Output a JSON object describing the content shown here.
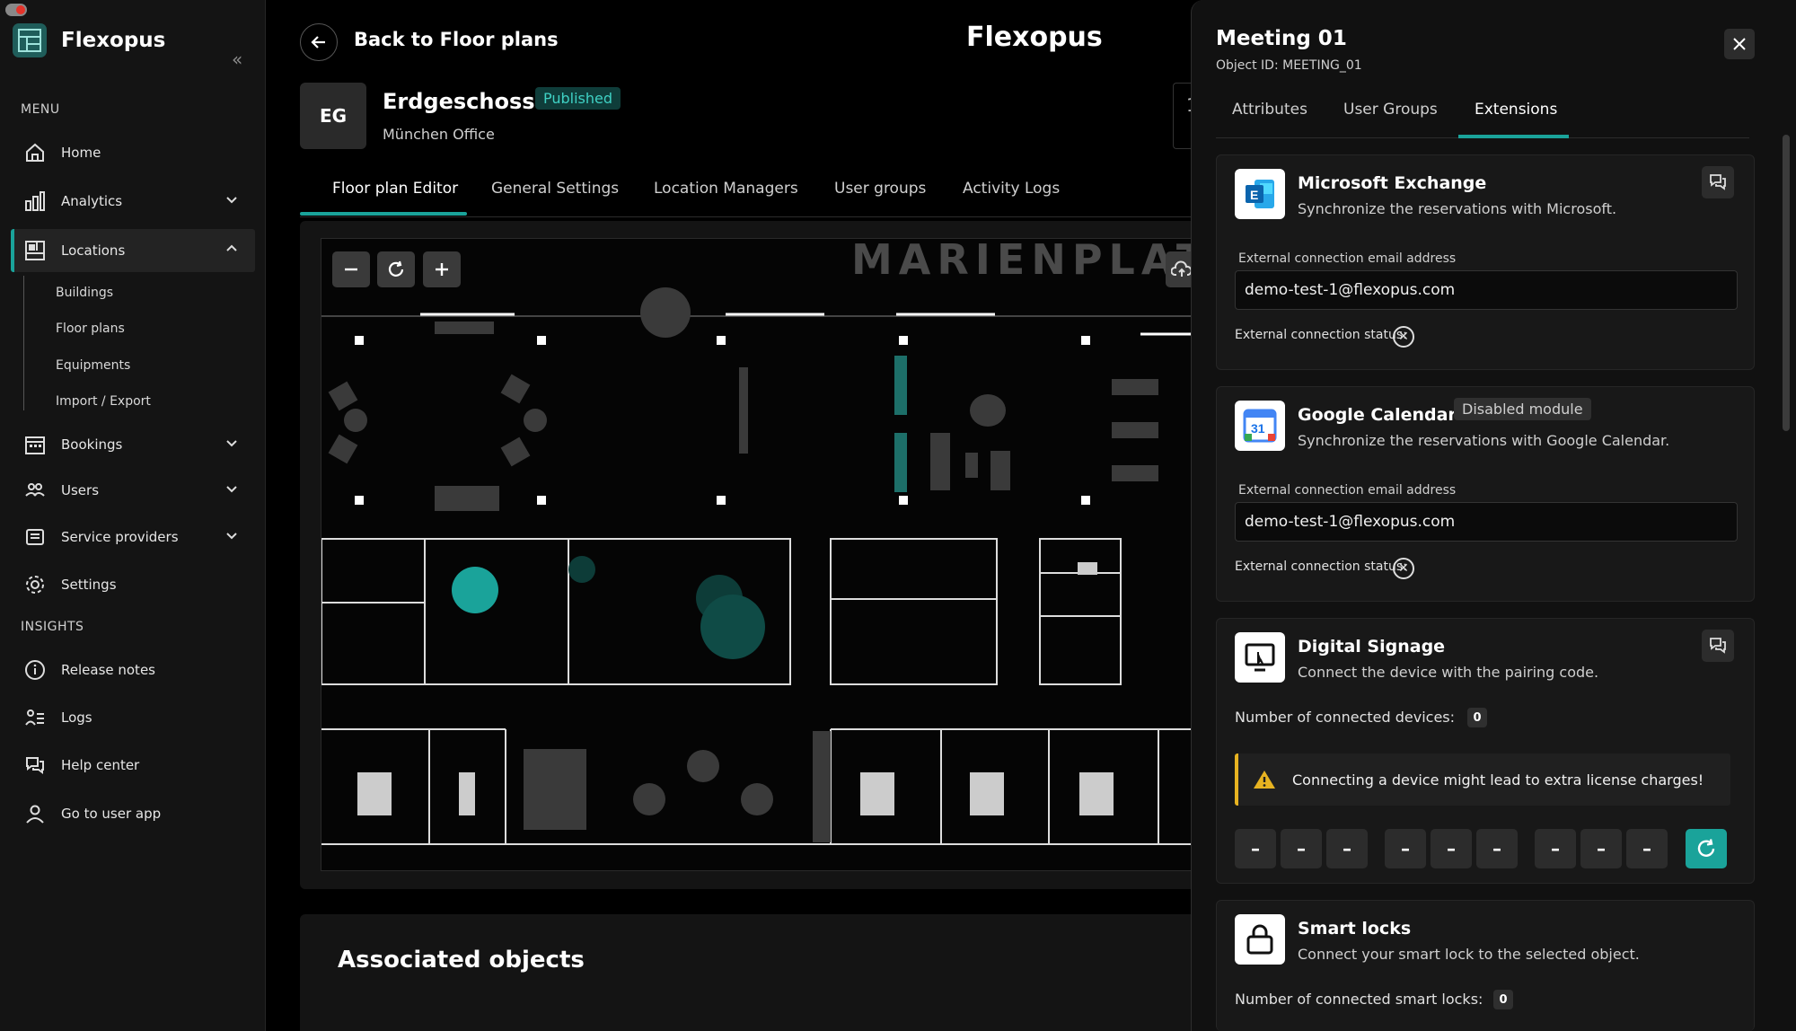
{
  "brand": {
    "name": "Flexopus",
    "collapse_glyph": "«",
    "accent_color": "#1aa39a"
  },
  "sidebar": {
    "menu_label": "MENU",
    "insights_label": "INSIGHTS",
    "items": [
      {
        "label": "Home",
        "icon": "home-icon"
      },
      {
        "label": "Analytics",
        "icon": "bar-chart-icon"
      },
      {
        "label": "Locations",
        "icon": "floor-plan-icon",
        "active": true
      },
      {
        "label": "Bookings",
        "icon": "calendar-icon"
      },
      {
        "label": "Users",
        "icon": "users-icon"
      },
      {
        "label": "Service providers",
        "icon": "id-card-icon"
      },
      {
        "label": "Settings",
        "icon": "gear-icon"
      }
    ],
    "location_subitems": [
      "Buildings",
      "Floor plans",
      "Equipments",
      "Import / Export"
    ],
    "insight_items": [
      {
        "label": "Release notes",
        "icon": "info-icon"
      },
      {
        "label": "Logs",
        "icon": "logs-icon"
      },
      {
        "label": "Help center",
        "icon": "chat-icon"
      },
      {
        "label": "Go to user app",
        "icon": "user-icon"
      }
    ]
  },
  "header": {
    "back_label": "Back to Floor plans",
    "app_title": "Flexopus"
  },
  "floor": {
    "abbrev": "EG",
    "name": "Erdgeschoss",
    "status": "Published",
    "location": "München Office",
    "peek_char": "1"
  },
  "tabs": [
    "Floor plan Editor",
    "General Settings",
    "Location Managers",
    "User groups",
    "Activity Logs"
  ],
  "plan": {
    "label": "MARIENPLATZ"
  },
  "associated": {
    "title": "Associated objects"
  },
  "panel": {
    "title": "Meeting 01",
    "object_id": "Object ID: MEETING_01",
    "tabs": [
      "Attributes",
      "User Groups",
      "Extensions"
    ],
    "active_tab": "Extensions",
    "exchange": {
      "name": "Microsoft Exchange",
      "desc": "Synchronize the reservations with Microsoft.",
      "email_label": "External connection email address",
      "email_value": "demo-test-1@flexopus.com",
      "status_label": "External connection status:"
    },
    "google": {
      "name": "Google Calendar",
      "badge": "Disabled module",
      "desc": "Synchronize the reservations with Google Calendar.",
      "email_label": "External connection email address",
      "email_value": "demo-test-1@flexopus.com",
      "status_label": "External connection status:",
      "icon_text": "31"
    },
    "signage": {
      "name": "Digital Signage",
      "desc": "Connect the device with the pairing code.",
      "count_label": "Number of connected devices:",
      "count": "0",
      "warning": "Connecting a device might lead to extra license charges!",
      "code_placeholder": "–"
    },
    "locks": {
      "name": "Smart locks",
      "desc": "Connect your smart lock to the selected object.",
      "count_label": "Number of connected smart locks:",
      "count": "0"
    }
  }
}
